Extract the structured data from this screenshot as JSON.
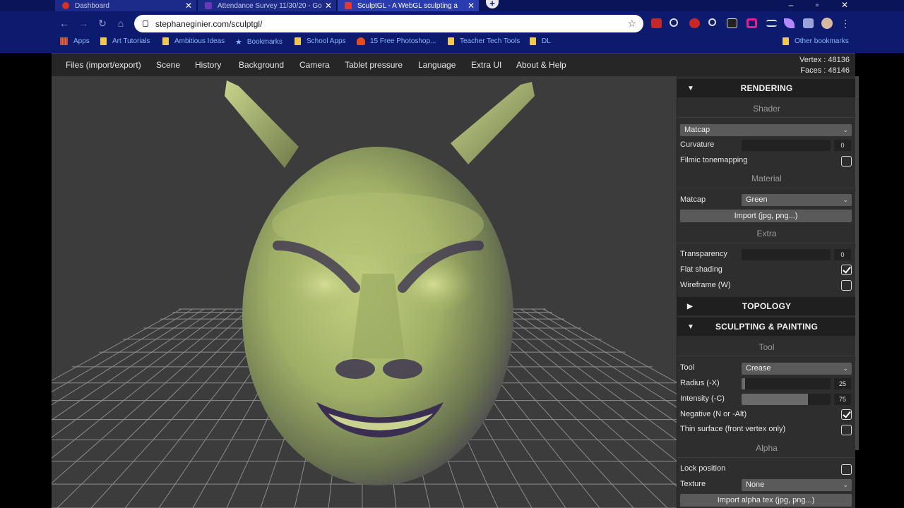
{
  "browser": {
    "tabs": [
      {
        "title": "Dashboard",
        "favicon_color": "#d93025"
      },
      {
        "title": "Attendance Survey 11/30/20 - Go",
        "favicon_color": "#673ab7"
      },
      {
        "title": "SculptGL - A WebGL sculpting a",
        "favicon_color": "#e53935"
      }
    ],
    "close_glyph": "✕",
    "new_tab_glyph": "+",
    "url": "stephaneginier.com/sculptgl/",
    "bookmarks": [
      {
        "label": "Apps",
        "icon": "apps-grid-icon"
      },
      {
        "label": "Art Tutorials",
        "icon": "folder-icon"
      },
      {
        "label": "Ambitious Ideas",
        "icon": "folder-icon"
      },
      {
        "label": "Bookmarks",
        "icon": "star-icon"
      },
      {
        "label": "School Apps",
        "icon": "folder-icon"
      },
      {
        "label": "15 Free Photoshop...",
        "icon": "site-icon"
      },
      {
        "label": "Teacher Tech Tools",
        "icon": "folder-icon"
      },
      {
        "label": "DL",
        "icon": "folder-icon"
      }
    ],
    "other_bookmarks": "Other bookmarks"
  },
  "menu": {
    "items": [
      "Files (import/export)",
      "Scene",
      "History",
      "Background",
      "Camera",
      "Tablet pressure",
      "Language",
      "Extra UI",
      "About & Help"
    ],
    "vertex": "Vertex : 48136",
    "faces": "Faces : 48146"
  },
  "panel": {
    "rendering": {
      "title": "RENDERING",
      "shader_heading": "Shader",
      "shader_value": "Matcap",
      "curvature_label": "Curvature",
      "curvature_value": "0",
      "filmic_label": "Filmic tonemapping",
      "filmic_checked": false,
      "material_heading": "Material",
      "matcap_label": "Matcap",
      "matcap_value": "Green",
      "import_button": "Import (jpg, png...)",
      "extra_heading": "Extra",
      "transparency_label": "Transparency",
      "transparency_value": "0",
      "flat_label": "Flat shading",
      "flat_checked": true,
      "wireframe_label": "Wireframe (W)",
      "wireframe_checked": false
    },
    "topology": {
      "title": "TOPOLOGY"
    },
    "sculpting": {
      "title": "SCULPTING & PAINTING",
      "tool_heading": "Tool",
      "tool_label": "Tool",
      "tool_value": "Crease",
      "radius_label": "Radius (-X)",
      "radius_value": "25",
      "intensity_label": "Intensity (-C)",
      "intensity_value": "75",
      "negative_label": "Negative (N or -Alt)",
      "negative_checked": true,
      "thin_label": "Thin surface (front vertex only)",
      "thin_checked": false,
      "alpha_heading": "Alpha",
      "lock_label": "Lock position",
      "lock_checked": false,
      "texture_label": "Texture",
      "texture_value": "None",
      "import_alpha_button": "Import alpha tex (jpg, png...)"
    }
  },
  "colors": {
    "chrome_bg": "#0d1b6e",
    "model_green": "#a8b86a",
    "model_shadow": "#3a2f52",
    "grid_line": "#8a8a8a"
  }
}
